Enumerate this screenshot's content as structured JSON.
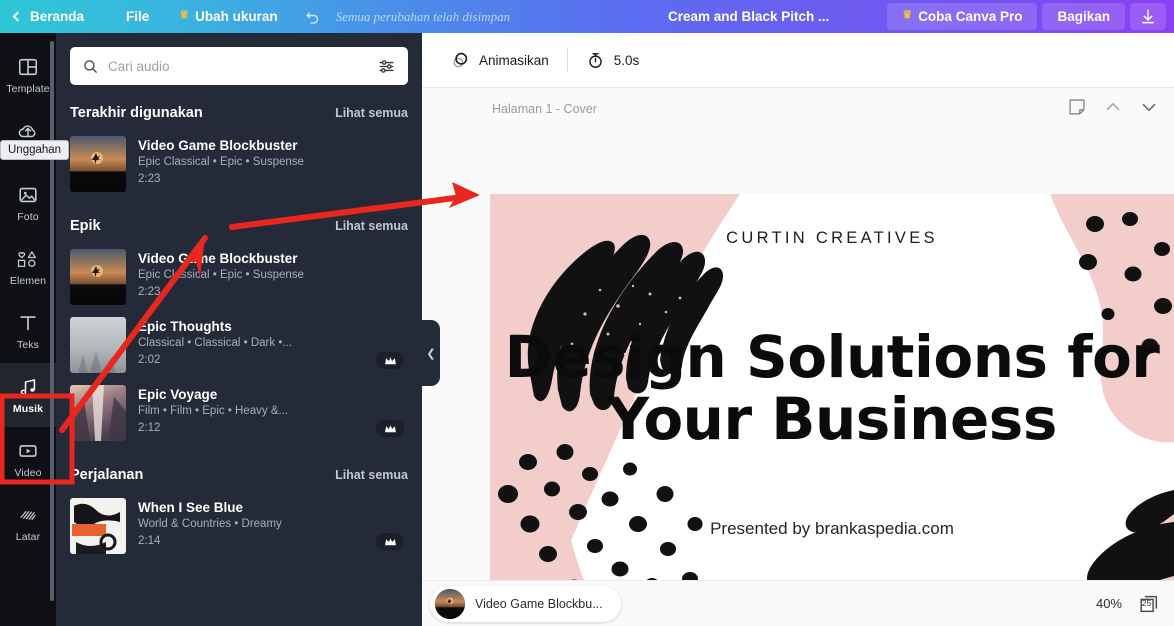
{
  "topbar": {
    "back_label": "Beranda",
    "file_label": "File",
    "resize_label": "Ubah ukuran",
    "resize_icon": "crown-icon",
    "undo_icon": "undo-arrow-icon",
    "saved_message": "Semua perubahan telah disimpan",
    "doc_title": "Cream and Black Pitch ...",
    "pro_label": "Coba Canva Pro",
    "pro_icon": "crown-icon",
    "share_label": "Bagikan",
    "download_icon": "download-icon"
  },
  "rail": {
    "items": [
      {
        "label": "Template",
        "icon": "template-layout-icon",
        "active": false
      },
      {
        "label": "Unggahan",
        "icon": "cloud-upload-icon",
        "active": false
      },
      {
        "label": "Foto",
        "icon": "photo-image-icon",
        "active": false
      },
      {
        "label": "Elemen",
        "icon": "shapes-elements-icon",
        "active": false
      },
      {
        "label": "Teks",
        "icon": "text-t-icon",
        "active": false
      },
      {
        "label": "Musik",
        "icon": "music-note-icon",
        "active": true
      },
      {
        "label": "Video",
        "icon": "video-play-icon",
        "active": false
      },
      {
        "label": "Latar",
        "icon": "background-hatch-icon",
        "active": false
      }
    ],
    "tooltip": "Unggahan"
  },
  "panel": {
    "search_placeholder": "Cari audio",
    "search_value": "",
    "search_icon": "search-icon",
    "filter_icon": "sliders-filter-icon",
    "collapse_icon": "chevron-left-icon",
    "sections": [
      {
        "title": "Terakhir digunakan",
        "link": "Lihat semua",
        "tracks": [
          {
            "name": "Video Game Blockbuster",
            "tags": "Epic Classical • Epic • Suspense",
            "duration": "2:23",
            "pro": false,
            "thumb": "sunset-silhouette"
          }
        ]
      },
      {
        "title": "Epik",
        "link": "Lihat semua",
        "tracks": [
          {
            "name": "Video Game Blockbuster",
            "tags": "Epic Classical • Epic • Suspense",
            "duration": "2:23",
            "pro": false,
            "thumb": "sunset-silhouette"
          },
          {
            "name": "Epic Thoughts",
            "tags": "Classical • Classical • Dark •...",
            "duration": "2:02",
            "pro": true,
            "thumb": "foggy-forest"
          },
          {
            "name": "Epic Voyage",
            "tags": "Film • Film • Epic • Heavy &...",
            "duration": "2:12",
            "pro": true,
            "thumb": "waterfall"
          }
        ]
      },
      {
        "title": "Perjalanan",
        "link": "Lihat semua",
        "tracks": [
          {
            "name": "When I See Blue",
            "tags": "World & Countries • Dreamy",
            "duration": "2:14",
            "pro": true,
            "thumb": "abstract-bw-orange"
          }
        ]
      }
    ]
  },
  "editor": {
    "animate_label": "Animasikan",
    "animate_icon": "animate-circles-icon",
    "timer_label": "5.0s",
    "timer_icon": "stopwatch-icon",
    "page_label": "Halaman 1 - Cover",
    "notes_icon": "notes-page-icon",
    "prev_page_icon": "chevron-up-icon",
    "next_page_icon": "chevron-down-icon"
  },
  "design": {
    "eyebrow": "CURTIN CREATIVES",
    "headline_line1": "Design Solutions for",
    "headline_line2": "Your Business",
    "footer": "Presented by brankaspedia.com",
    "colors": {
      "pink": "#f2cdc9",
      "black": "#111111",
      "white": "#ffffff"
    }
  },
  "bottombar": {
    "audio_chip_label": "Video Game Blockbu...",
    "audio_chip_icon": "audio-thumb-icon",
    "zoom_level": "40%",
    "page_count": "25",
    "page_count_icon": "pages-stack-icon"
  },
  "annotations": {
    "accent_color": "#e8271f",
    "highlight_target": "Musik",
    "arrow1": "musik-to-track-arrow",
    "arrow2": "track-to-canvas-arrow",
    "box": "musik-highlight-box"
  }
}
